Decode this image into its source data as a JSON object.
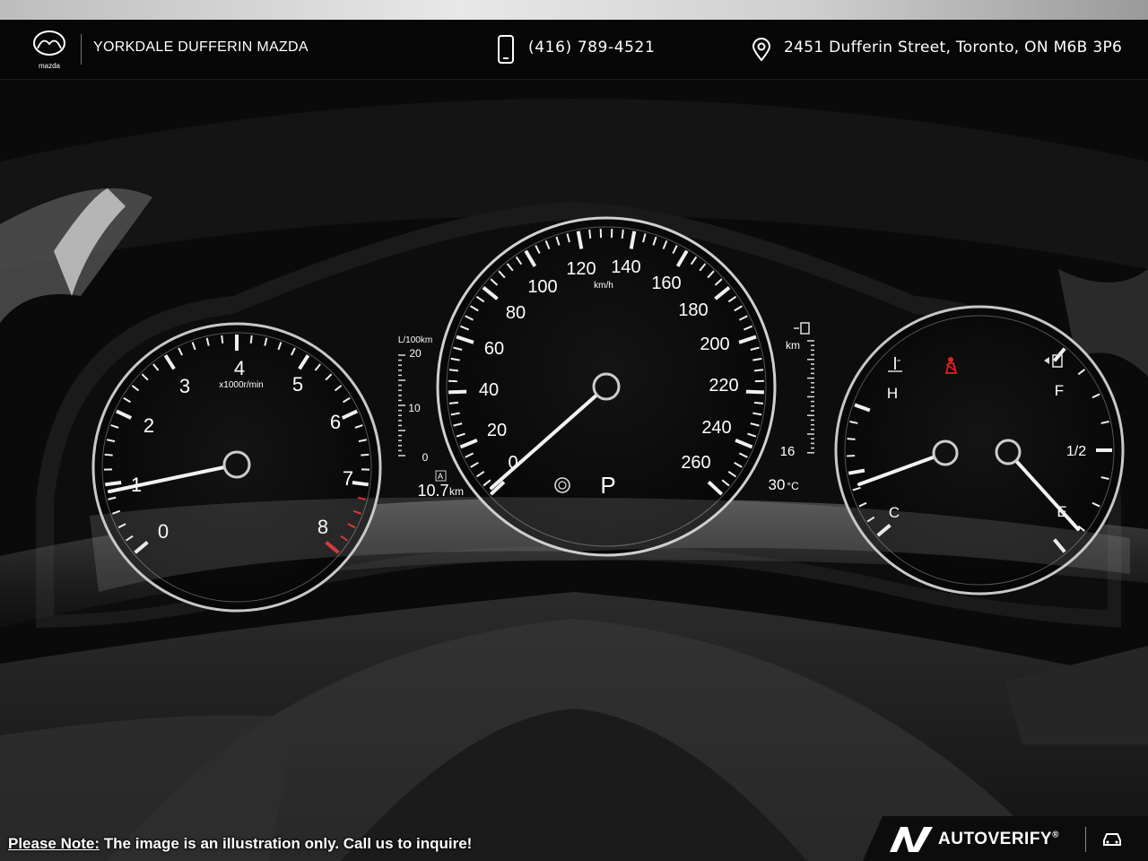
{
  "header": {
    "dealer_name": "YORKDALE DUFFERIN MAZDA",
    "logo_caption": "mazda",
    "phone": "(416) 789-4521",
    "address": "2451 Dufferin Street, Toronto, ON M6B 3P6",
    "icons": [
      "mazda-logo",
      "phone-icon",
      "location-pin-icon"
    ]
  },
  "gauges": {
    "tachometer": {
      "ticks": [
        "0",
        "1",
        "2",
        "3",
        "4",
        "5",
        "6",
        "7",
        "8"
      ],
      "unit": "x1000r/min"
    },
    "fuel_economy": {
      "unit": "L/100km",
      "ticks": [
        "20",
        "10",
        "0"
      ],
      "mode_badge": "A",
      "value": "10.7",
      "value_unit": "km"
    },
    "speedometer": {
      "ticks": [
        "0",
        "20",
        "40",
        "60",
        "80",
        "100",
        "120",
        "140",
        "160",
        "180",
        "200",
        "220",
        "240",
        "260"
      ],
      "unit": "km/h",
      "gear": "P"
    },
    "range": {
      "unit": "km",
      "value": "16",
      "outside_temp": "30",
      "temp_unit": "°C"
    },
    "temperature": {
      "hot": "H",
      "cold": "C"
    },
    "fuel": {
      "full": "F",
      "half": "1/2",
      "empty": "E"
    }
  },
  "footer": {
    "note_label": "Please Note:",
    "note_text": " The image is an illustration only. Call us to inquire!",
    "badge_name": "AUTOVERIFY",
    "badge_reg": "®"
  }
}
